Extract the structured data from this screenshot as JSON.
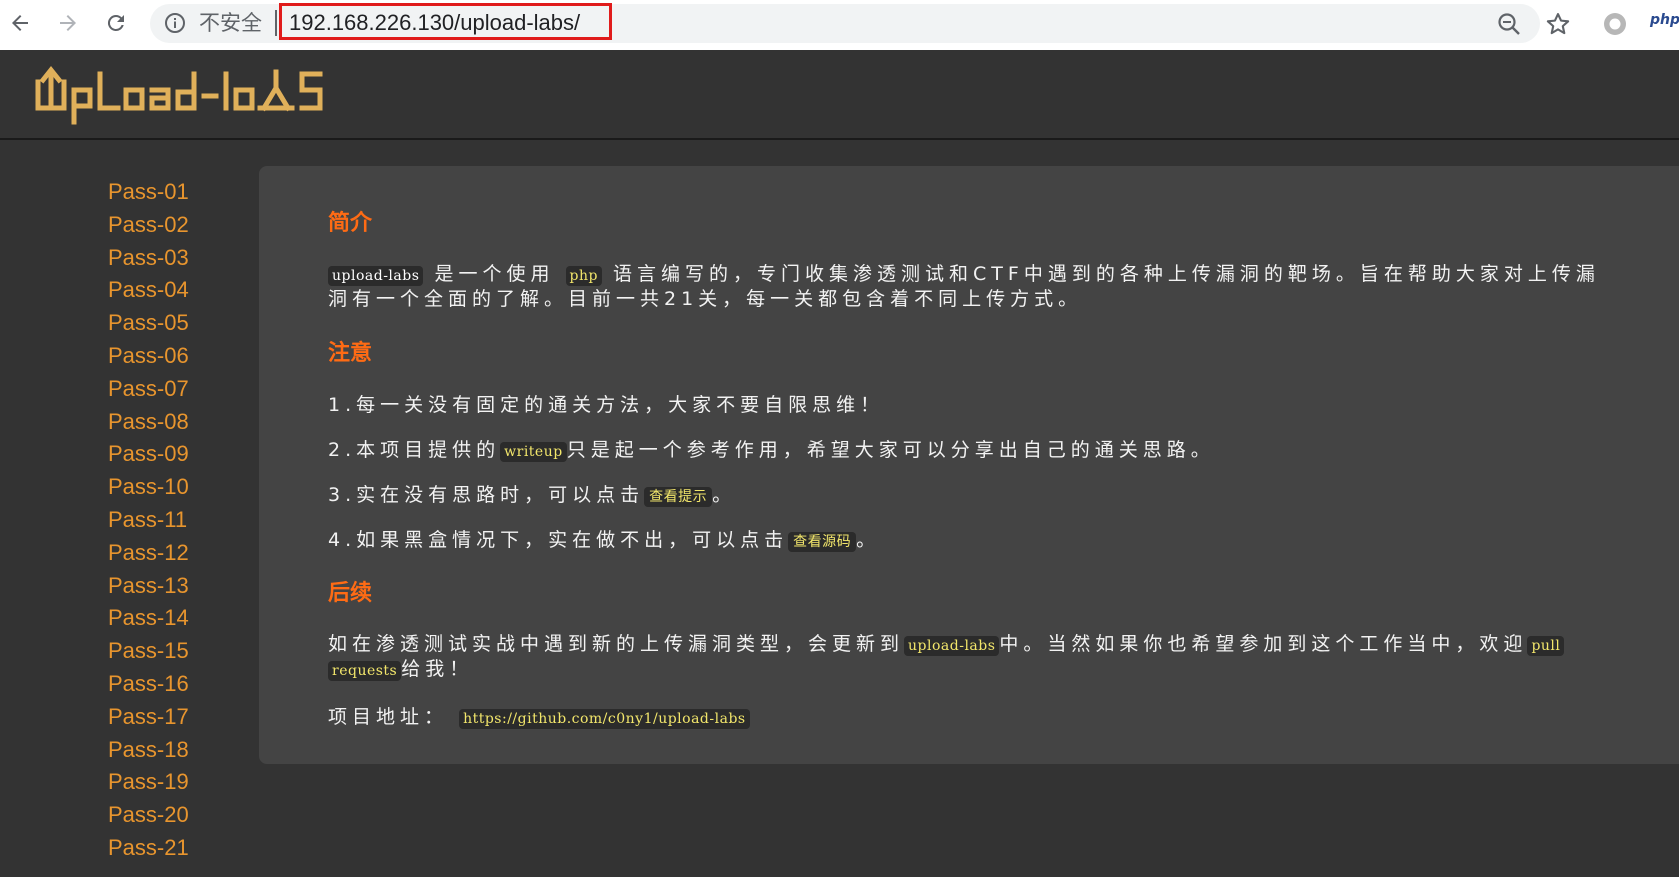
{
  "browser": {
    "security_label": "不安全",
    "url": "192.168.226.130/upload-labs/",
    "extension_label": "php",
    "accent_color": "#e01b1b"
  },
  "site": {
    "logo_text": "Upload-labs"
  },
  "sidebar": {
    "items": [
      "Pass-01",
      "Pass-02",
      "Pass-03",
      "Pass-04",
      "Pass-05",
      "Pass-06",
      "Pass-07",
      "Pass-08",
      "Pass-09",
      "Pass-10",
      "Pass-11",
      "Pass-12",
      "Pass-13",
      "Pass-14",
      "Pass-15",
      "Pass-16",
      "Pass-17",
      "Pass-18",
      "Pass-19",
      "Pass-20",
      "Pass-21"
    ],
    "link_color": "#e8952e"
  },
  "content": {
    "intro": {
      "title": "简介",
      "code1": "upload-labs",
      "t1": "是一个使用",
      "code2": "php",
      "t2": "语言编写的，专门收集渗透测试和CTF中遇到的各种上传漏洞的靶场。旨在帮助大家对上传漏",
      "line2": "洞有一个全面的了解。目前一共21关，每一关都包含着不同上传方式。"
    },
    "notes": {
      "title": "注意",
      "n1": "1.每一关没有固定的通关方法，大家不要自限思维！",
      "n2_a": "2.本项目提供的",
      "n2_code": "writeup",
      "n2_b": "只是起一个参考作用，希望大家可以分享出自己的通关思路。",
      "n3_a": "3.实在没有思路时，可以点击",
      "n3_btn": "查看提示",
      "n3_b": "。",
      "n4_a": "4.如果黑盒情况下，实在做不出，可以点击",
      "n4_btn": "查看源码",
      "n4_b": "。"
    },
    "followup": {
      "title": "后续",
      "t1": "如在渗透测试实战中遇到新的上传漏洞类型，会更新到",
      "code1": "upload-labs",
      "t2": "中。当然如果你也希望参加到这个工作当中，欢迎",
      "code2a": "pull",
      "code2b": "requests",
      "t3": "给我！",
      "addr_label": "项目地址：",
      "addr_url": "https://github.com/c0ny1/upload-labs"
    },
    "title_color": "#ff6b14"
  }
}
